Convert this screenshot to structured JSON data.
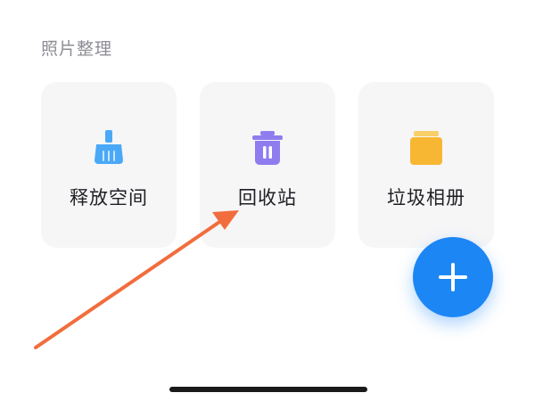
{
  "section": {
    "title": "照片整理"
  },
  "cards": [
    {
      "label": "释放空间",
      "icon": "broom-icon",
      "color": "#4aa8f7"
    },
    {
      "label": "回收站",
      "icon": "trash-icon",
      "color": "#8f7df0"
    },
    {
      "label": "垃圾相册",
      "icon": "album-icon",
      "color": "#f7b733"
    }
  ],
  "fab": {
    "icon": "plus-icon",
    "color": "#1d86f5"
  },
  "annotation": {
    "icon": "arrow-icon",
    "color": "#f26d3d"
  }
}
